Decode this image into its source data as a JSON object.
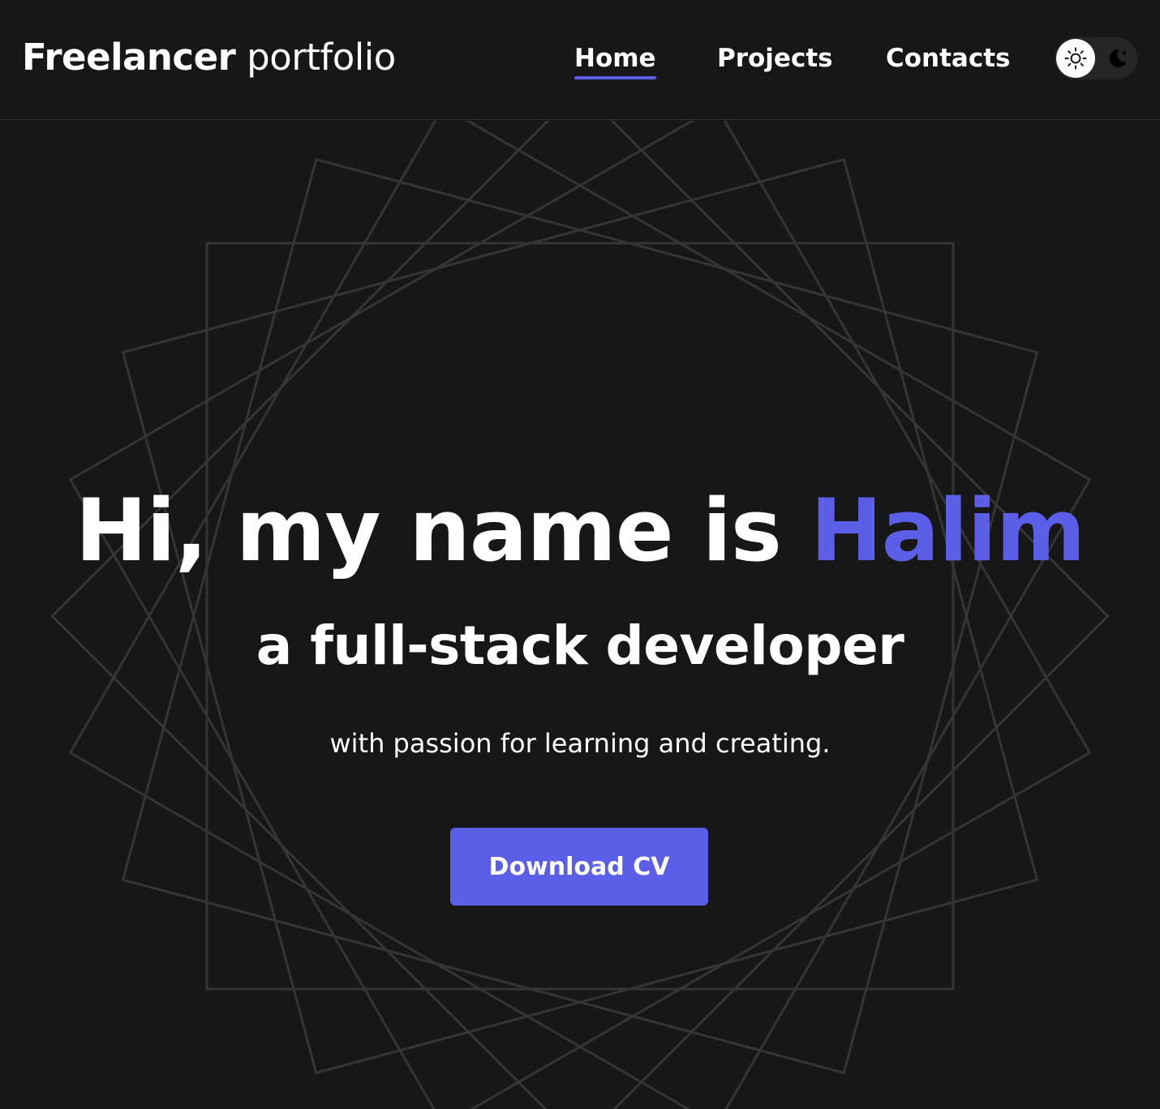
{
  "header": {
    "logo_bold": "Freelancer",
    "logo_light": "portfolio",
    "nav": [
      {
        "label": "Home",
        "active": true
      },
      {
        "label": "Projects",
        "active": false
      },
      {
        "label": "Contacts",
        "active": false
      }
    ],
    "theme_toggle": {
      "selected": "light",
      "options": [
        "sun-icon",
        "moon-icon"
      ]
    }
  },
  "hero": {
    "title_prefix": "Hi, my name is",
    "title_name": "Halim",
    "subtitle": "a full-stack developer",
    "tagline": "with passion for learning and creating.",
    "cta_label": "Download CV"
  },
  "colors": {
    "background": "#171717",
    "accent": "#5b5ee6",
    "text": "#ffffff",
    "decor_lines": "#333333"
  }
}
